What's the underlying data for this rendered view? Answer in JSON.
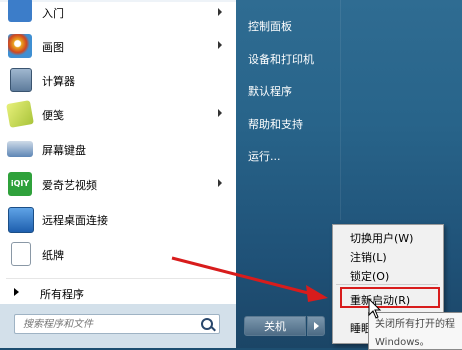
{
  "programs": [
    {
      "label": "入门",
      "icon": "getting-started-icon",
      "has_arrow": true,
      "color": "#3c7dc9"
    },
    {
      "label": "画图",
      "icon": "paint-icon",
      "has_arrow": true,
      "color": "#e9a51f"
    },
    {
      "label": "计算器",
      "icon": "calculator-icon",
      "has_arrow": false,
      "color": "#6f8fb2"
    },
    {
      "label": "便笺",
      "icon": "sticky-notes-icon",
      "has_arrow": true,
      "color": "#c6d94a"
    },
    {
      "label": "屏幕键盘",
      "icon": "keyboard-icon",
      "has_arrow": false,
      "color": "#3f6fa3"
    },
    {
      "label": "爱奇艺视频",
      "icon": "iqiyi-icon",
      "has_arrow": true,
      "color": "#2fa13b"
    },
    {
      "label": "远程桌面连接",
      "icon": "remote-desktop-icon",
      "has_arrow": false,
      "color": "#2d6cb5"
    },
    {
      "label": "纸牌",
      "icon": "solitaire-icon",
      "has_arrow": false,
      "color": "#b8c4cf"
    }
  ],
  "all_programs_label": "所有程序",
  "search": {
    "placeholder": "搜索程序和文件"
  },
  "right_links": [
    "控制面板",
    "设备和打印机",
    "默认程序",
    "帮助和支持",
    "运行..."
  ],
  "shutdown_label": "关机",
  "power_menu": {
    "items": [
      "切换用户(W)",
      "注销(L)",
      "锁定(O)",
      "重新启动(R)",
      "睡眠"
    ],
    "highlighted": "重新启动(R)"
  },
  "tooltip": {
    "line1": "关闭所有打开的程",
    "line2": "Windows。"
  },
  "colors": {
    "annotation": "#d81c1c",
    "right_panel": "#28648a"
  }
}
